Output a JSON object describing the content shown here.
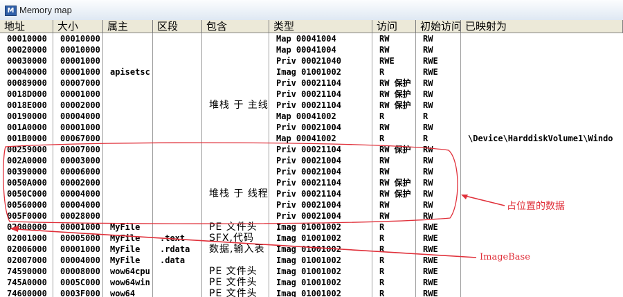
{
  "window": {
    "title": "Memory map",
    "icon_letter": "M"
  },
  "columns": [
    "地址",
    "大小",
    "属主",
    "区段",
    "包含",
    "类型",
    "访问",
    "初始访问",
    "已映射为"
  ],
  "rows": [
    [
      "00010000",
      "00010000",
      "",
      "",
      "",
      "Map  00041004",
      "RW",
      "RW",
      ""
    ],
    [
      "00020000",
      "00010000",
      "",
      "",
      "",
      "Map  00041004",
      "RW",
      "RW",
      ""
    ],
    [
      "00030000",
      "00001000",
      "",
      "",
      "",
      "Priv 00021040",
      "RWE",
      "RWE",
      ""
    ],
    [
      "00040000",
      "00001000",
      "apisetsc",
      "",
      "",
      "Imag 01001002",
      "R",
      "RWE",
      ""
    ],
    [
      "00089000",
      "00007000",
      "",
      "",
      "",
      "Priv 00021104",
      "RW  保护",
      "RW",
      ""
    ],
    [
      "0018D000",
      "00001000",
      "",
      "",
      "",
      "Priv 00021104",
      "RW  保护",
      "RW",
      ""
    ],
    [
      "0018E000",
      "00002000",
      "",
      "",
      "堆栈 于  主线",
      "Priv 00021104",
      "RW  保护",
      "RW",
      ""
    ],
    [
      "00190000",
      "00004000",
      "",
      "",
      "",
      "Map  00041002",
      "R",
      "R",
      ""
    ],
    [
      "001A0000",
      "00001000",
      "",
      "",
      "",
      "Priv 00021004",
      "RW",
      "RW",
      ""
    ],
    [
      "001B0000",
      "00067000",
      "",
      "",
      "",
      "Map  00041002",
      "R",
      "R",
      "\\Device\\HarddiskVolume1\\Windo"
    ],
    [
      "00259000",
      "00007000",
      "",
      "",
      "",
      "Priv 00021104",
      "RW  保护",
      "RW",
      ""
    ],
    [
      "002A0000",
      "00003000",
      "",
      "",
      "",
      "Priv 00021004",
      "RW",
      "RW",
      ""
    ],
    [
      "00390000",
      "00006000",
      "",
      "",
      "",
      "Priv 00021004",
      "RW",
      "RW",
      ""
    ],
    [
      "0050A000",
      "00002000",
      "",
      "",
      "",
      "Priv 00021104",
      "RW  保护",
      "RW",
      ""
    ],
    [
      "0050C000",
      "00004000",
      "",
      "",
      "堆栈 于  线程",
      "Priv 00021104",
      "RW  保护",
      "RW",
      ""
    ],
    [
      "00560000",
      "00004000",
      "",
      "",
      "",
      "Priv 00021004",
      "RW",
      "RW",
      ""
    ],
    [
      "005F0000",
      "00028000",
      "",
      "",
      "",
      "Priv 00021004",
      "RW",
      "RW",
      ""
    ],
    [
      "02000000",
      "00001000",
      "MyFile",
      "",
      "PE 文件头",
      "Imag 01001002",
      "R",
      "RWE",
      ""
    ],
    [
      "02001000",
      "00005000",
      "MyFile",
      ".text",
      "SFX,代码",
      "Imag 01001002",
      "R",
      "RWE",
      ""
    ],
    [
      "02006000",
      "00001000",
      "MyFile",
      ".rdata",
      "数据,输入表",
      "Imag 01001002",
      "R",
      "RWE",
      ""
    ],
    [
      "02007000",
      "00004000",
      "MyFile",
      ".data",
      "",
      "Imag 01001002",
      "R",
      "RWE",
      ""
    ],
    [
      "74590000",
      "00008000",
      "wow64cpu",
      "",
      "PE 文件头",
      "Imag 01001002",
      "R",
      "RWE",
      ""
    ],
    [
      "745A0000",
      "0005C000",
      "wow64win",
      "",
      "PE 文件头",
      "Imag 01001002",
      "R",
      "RWE",
      ""
    ],
    [
      "74600000",
      "0003F000",
      "wow64",
      "",
      "PE 文件头",
      "Imag 01001002",
      "R",
      "RWE",
      ""
    ]
  ],
  "annotations": {
    "occupied_label": "占位置的数据",
    "imagebase_label": "ImageBase",
    "color": "#e0303a"
  }
}
